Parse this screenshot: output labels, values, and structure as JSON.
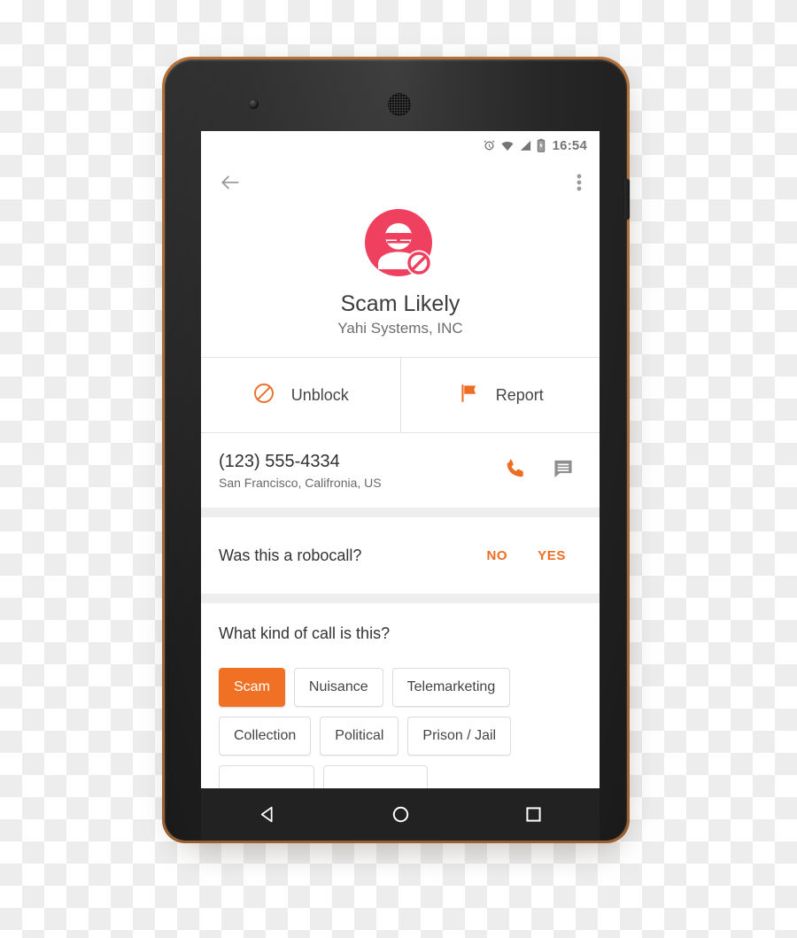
{
  "device": {
    "type": "android-phone",
    "frame_color": "#1f1f1f",
    "trim_color": "#a9682f"
  },
  "status_bar": {
    "time": "16:54",
    "icons": [
      "alarm-icon",
      "wifi-icon",
      "cellular-signal-icon",
      "battery-icon"
    ]
  },
  "app_bar": {
    "back_icon": "back-arrow-icon",
    "overflow_icon": "overflow-menu-icon"
  },
  "caller": {
    "avatar_icon": "scam-caller-blocked-avatar",
    "avatar_color": "#ef4060",
    "name": "Scam Likely",
    "organization": "Yahi Systems, INC"
  },
  "actions": [
    {
      "label": "Unblock",
      "icon": "block-circle-icon",
      "color": "#e8702a"
    },
    {
      "label": "Report",
      "icon": "flag-icon",
      "color": "#ef6c23"
    }
  ],
  "number": {
    "phone": "(123) 555-4334",
    "location": "San Francisco, Califronia, US",
    "call_icon": "phone-call-icon",
    "call_icon_color": "#ef6c23",
    "message_icon": "message-bubble-icon",
    "message_icon_color": "#8e8e8e"
  },
  "robocall": {
    "question": "Was this a robocall?",
    "no_label": "NO",
    "yes_label": "YES",
    "accent_color": "#ef6c23"
  },
  "call_kind": {
    "question": "What kind of call is this?",
    "selected": "Scam",
    "selected_color": "#f07124",
    "rows": [
      [
        "Scam",
        "Nuisance",
        "Telemarketing"
      ],
      [
        "Collection",
        "Political",
        "Prison / Jail"
      ],
      [
        "",
        ""
      ]
    ]
  },
  "nav_bar": {
    "back_icon": "nav-back-triangle-icon",
    "home_icon": "nav-home-circle-icon",
    "recents_icon": "nav-recents-square-icon"
  }
}
